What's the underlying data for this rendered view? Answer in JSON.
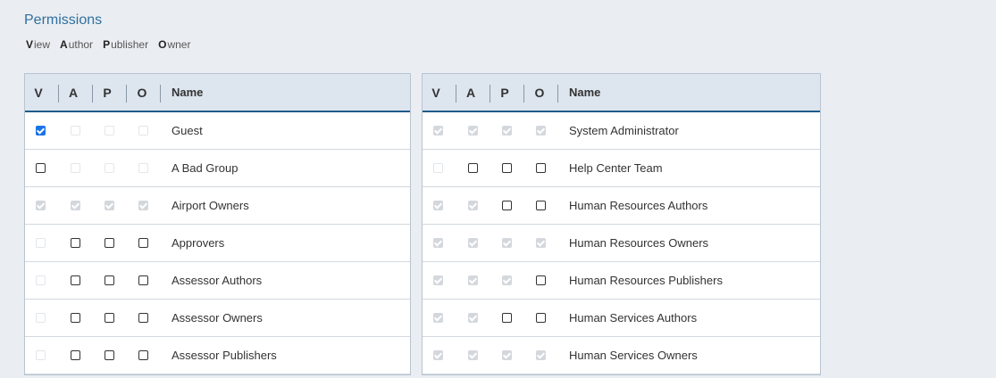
{
  "title": "Permissions",
  "legend": [
    {
      "key": "V",
      "rest": "iew"
    },
    {
      "key": "A",
      "rest": "uthor"
    },
    {
      "key": "P",
      "rest": "ublisher"
    },
    {
      "key": "O",
      "rest": "wner"
    }
  ],
  "columns": {
    "v": "V",
    "a": "A",
    "p": "P",
    "o": "O",
    "name": "Name"
  },
  "left_rows": [
    {
      "name": "Guest",
      "states": [
        "checked",
        "disabled",
        "disabled",
        "disabled"
      ]
    },
    {
      "name": "A Bad Group",
      "states": [
        "unchecked",
        "disabled",
        "disabled",
        "disabled"
      ]
    },
    {
      "name": "Airport Owners",
      "states": [
        "disabled-checked",
        "disabled-checked",
        "disabled-checked",
        "disabled-checked"
      ]
    },
    {
      "name": "Approvers",
      "states": [
        "disabled",
        "unchecked",
        "unchecked",
        "unchecked"
      ]
    },
    {
      "name": "Assessor Authors",
      "states": [
        "disabled",
        "unchecked",
        "unchecked",
        "unchecked"
      ]
    },
    {
      "name": "Assessor Owners",
      "states": [
        "disabled",
        "unchecked",
        "unchecked",
        "unchecked"
      ]
    },
    {
      "name": "Assessor Publishers",
      "states": [
        "disabled",
        "unchecked",
        "unchecked",
        "unchecked"
      ]
    }
  ],
  "right_rows": [
    {
      "name": "System Administrator",
      "states": [
        "disabled-checked",
        "disabled-checked",
        "disabled-checked",
        "disabled-checked"
      ]
    },
    {
      "name": "Help Center Team",
      "states": [
        "disabled",
        "unchecked",
        "unchecked",
        "unchecked"
      ]
    },
    {
      "name": "Human Resources Authors",
      "states": [
        "disabled-checked",
        "disabled-checked",
        "unchecked",
        "unchecked"
      ]
    },
    {
      "name": "Human Resources Owners",
      "states": [
        "disabled-checked",
        "disabled-checked",
        "disabled-checked",
        "disabled-checked"
      ]
    },
    {
      "name": "Human Resources Publishers",
      "states": [
        "disabled-checked",
        "disabled-checked",
        "disabled-checked",
        "unchecked"
      ]
    },
    {
      "name": "Human Services Authors",
      "states": [
        "disabled-checked",
        "disabled-checked",
        "unchecked",
        "unchecked"
      ]
    },
    {
      "name": "Human Services Owners",
      "states": [
        "disabled-checked",
        "disabled-checked",
        "disabled-checked",
        "disabled-checked"
      ]
    }
  ]
}
